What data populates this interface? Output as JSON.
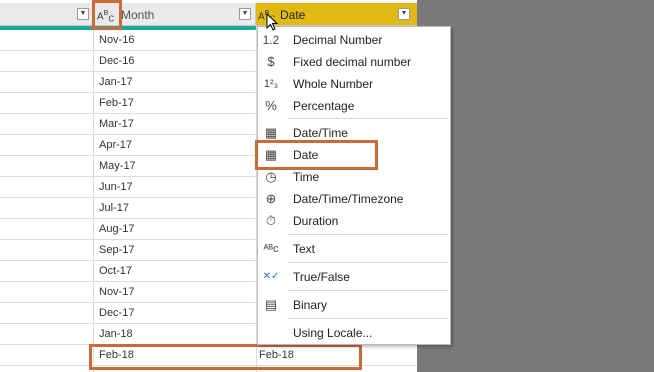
{
  "header": {
    "month_label": "Month",
    "date_label": "Date",
    "month_type_icon": "text-type-icon",
    "date_type_icon": "text-type-icon"
  },
  "rows": [
    {
      "month": "Nov-16",
      "date": ""
    },
    {
      "month": "Dec-16",
      "date": ""
    },
    {
      "month": "Jan-17",
      "date": ""
    },
    {
      "month": "Feb-17",
      "date": ""
    },
    {
      "month": "Mar-17",
      "date": ""
    },
    {
      "month": "Apr-17",
      "date": ""
    },
    {
      "month": "May-17",
      "date": ""
    },
    {
      "month": "Jun-17",
      "date": ""
    },
    {
      "month": "Jul-17",
      "date": ""
    },
    {
      "month": "Aug-17",
      "date": ""
    },
    {
      "month": "Sep-17",
      "date": ""
    },
    {
      "month": "Oct-17",
      "date": ""
    },
    {
      "month": "Nov-17",
      "date": ""
    },
    {
      "month": "Dec-17",
      "date": ""
    },
    {
      "month": "Jan-18",
      "date": ""
    },
    {
      "month": "Feb-18",
      "date": "Feb-18"
    }
  ],
  "type_menu": {
    "items": [
      {
        "label": "Decimal Number",
        "icon": "decimal-icon"
      },
      {
        "label": "Fixed decimal number",
        "icon": "dollar-icon"
      },
      {
        "label": "Whole Number",
        "icon": "whole-number-icon"
      },
      {
        "label": "Percentage",
        "icon": "percent-icon"
      },
      {
        "label": "Date/Time",
        "icon": "datetime-icon"
      },
      {
        "label": "Date",
        "icon": "calendar-icon"
      },
      {
        "label": "Time",
        "icon": "clock-icon"
      },
      {
        "label": "Date/Time/Timezone",
        "icon": "globe-clock-icon"
      },
      {
        "label": "Duration",
        "icon": "stopwatch-icon"
      },
      {
        "label": "Text",
        "icon": "text-type-icon"
      },
      {
        "label": "True/False",
        "icon": "true-false-icon"
      },
      {
        "label": "Binary",
        "icon": "binary-icon"
      },
      {
        "label": "Using Locale...",
        "icon": ""
      }
    ],
    "selected": "Date"
  },
  "colors": {
    "selected_header": "#e1b912",
    "highlight_box": "#cc6a3a",
    "column_bar": "#1cab9a"
  }
}
